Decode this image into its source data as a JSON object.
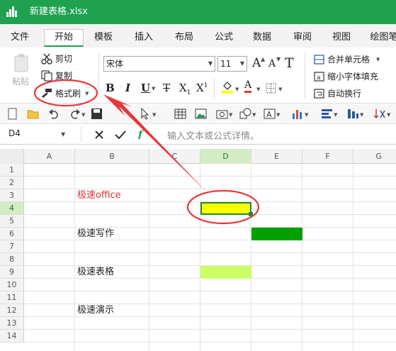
{
  "window": {
    "title": "新建表格.xlsx"
  },
  "tabs": [
    "文件",
    "开始",
    "模板",
    "插入",
    "布局",
    "公式",
    "数据",
    "审阅",
    "视图",
    "绘图笔"
  ],
  "active_tab": "开始",
  "ribbon": {
    "paste_label": "粘贴",
    "cut_label": "剪切",
    "copy_label": "复制",
    "format_painter_label": "格式刷",
    "font_name": "宋体",
    "font_size": "11",
    "merge_label": "合并单元格",
    "shrink_label": "缩小字体填充",
    "wrap_label": "自动换行",
    "bold": "B",
    "italic": "I",
    "underline": "U",
    "strike": "T",
    "subscript": "X",
    "sub_mark": "1",
    "superscript": "X",
    "sup_mark": "1",
    "grow_font": "A",
    "shrink_font": "A",
    "clear_format": "T",
    "font_color_glyph": "A"
  },
  "formula_bar": {
    "name_box": "D4",
    "placeholder": "输入文本或公式详情。"
  },
  "grid": {
    "columns": [
      "A",
      "B",
      "C",
      "D",
      "E",
      "F",
      "G"
    ],
    "rows": [
      "1",
      "2",
      "3",
      "4",
      "5",
      "6",
      "7",
      "8",
      "9",
      "10",
      "11",
      "12",
      "13",
      "14"
    ],
    "cells": {
      "B3": "极速office",
      "B6": "极速写作",
      "B9": "极速表格",
      "B12": "极速演示"
    }
  },
  "colors": {
    "accent": "#1fa14f",
    "annotation": "#e8373b",
    "D4_fill": "#ffff00",
    "E6_fill": "#00a000",
    "D9_fill": "#ccff66",
    "B3_text": "#e03030"
  }
}
